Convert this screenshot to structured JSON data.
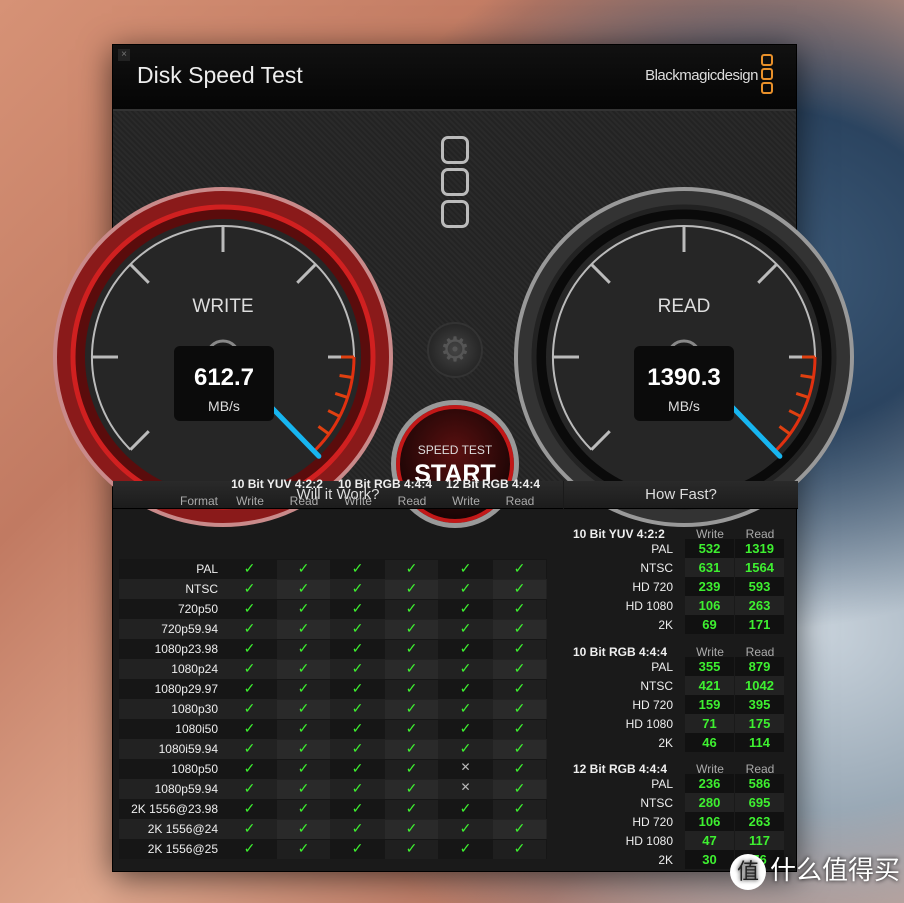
{
  "window": {
    "title": "Disk Speed Test",
    "brand": "Blackmagicdesign",
    "close": "×"
  },
  "gauges": {
    "write": {
      "label": "WRITE",
      "value": "612.7",
      "unit": "MB/s"
    },
    "read": {
      "label": "READ",
      "value": "1390.3",
      "unit": "MB/s"
    }
  },
  "start": {
    "top": "SPEED TEST",
    "label": "START"
  },
  "colors": {
    "accent": "#e8902a",
    "green": "#3ef030",
    "needle": "#17b5f0",
    "red": "#c21818"
  },
  "will_it_work": {
    "title": "Will it Work?",
    "format_label": "Format",
    "groups": [
      "10 Bit YUV 4:2:2",
      "10 Bit RGB 4:4:4",
      "12 Bit RGB 4:4:4"
    ],
    "subcols": [
      "Write",
      "Read",
      "Write",
      "Read",
      "Write",
      "Read"
    ],
    "rows": [
      {
        "format": "PAL",
        "ok": [
          1,
          1,
          1,
          1,
          1,
          1
        ]
      },
      {
        "format": "NTSC",
        "ok": [
          1,
          1,
          1,
          1,
          1,
          1
        ]
      },
      {
        "format": "720p50",
        "ok": [
          1,
          1,
          1,
          1,
          1,
          1
        ]
      },
      {
        "format": "720p59.94",
        "ok": [
          1,
          1,
          1,
          1,
          1,
          1
        ]
      },
      {
        "format": "1080p23.98",
        "ok": [
          1,
          1,
          1,
          1,
          1,
          1
        ]
      },
      {
        "format": "1080p24",
        "ok": [
          1,
          1,
          1,
          1,
          1,
          1
        ]
      },
      {
        "format": "1080p29.97",
        "ok": [
          1,
          1,
          1,
          1,
          1,
          1
        ]
      },
      {
        "format": "1080p30",
        "ok": [
          1,
          1,
          1,
          1,
          1,
          1
        ]
      },
      {
        "format": "1080i50",
        "ok": [
          1,
          1,
          1,
          1,
          1,
          1
        ]
      },
      {
        "format": "1080i59.94",
        "ok": [
          1,
          1,
          1,
          1,
          1,
          1
        ]
      },
      {
        "format": "1080p50",
        "ok": [
          1,
          1,
          1,
          1,
          0,
          1
        ]
      },
      {
        "format": "1080p59.94",
        "ok": [
          1,
          1,
          1,
          1,
          0,
          1
        ]
      },
      {
        "format": "2K 1556@23.98",
        "ok": [
          1,
          1,
          1,
          1,
          1,
          1
        ]
      },
      {
        "format": "2K 1556@24",
        "ok": [
          1,
          1,
          1,
          1,
          1,
          1
        ]
      },
      {
        "format": "2K 1556@25",
        "ok": [
          1,
          1,
          1,
          1,
          1,
          1
        ]
      }
    ]
  },
  "how_fast": {
    "title": "How Fast?",
    "write_label": "Write",
    "read_label": "Read",
    "groups": [
      {
        "name": "10 Bit YUV 4:2:2",
        "rows": [
          [
            "PAL",
            "532",
            "1319"
          ],
          [
            "NTSC",
            "631",
            "1564"
          ],
          [
            "HD 720",
            "239",
            "593"
          ],
          [
            "HD 1080",
            "106",
            "263"
          ],
          [
            "2K",
            "69",
            "171"
          ]
        ]
      },
      {
        "name": "10 Bit RGB 4:4:4",
        "rows": [
          [
            "PAL",
            "355",
            "879"
          ],
          [
            "NTSC",
            "421",
            "1042"
          ],
          [
            "HD 720",
            "159",
            "395"
          ],
          [
            "HD 1080",
            "71",
            "175"
          ],
          [
            "2K",
            "46",
            "114"
          ]
        ]
      },
      {
        "name": "12 Bit RGB 4:4:4",
        "rows": [
          [
            "PAL",
            "236",
            "586"
          ],
          [
            "NTSC",
            "280",
            "695"
          ],
          [
            "HD 720",
            "106",
            "263"
          ],
          [
            "HD 1080",
            "47",
            "117"
          ],
          [
            "2K",
            "30",
            "76"
          ]
        ]
      }
    ]
  },
  "watermark": {
    "icon": "值",
    "text": "什么值得买"
  }
}
